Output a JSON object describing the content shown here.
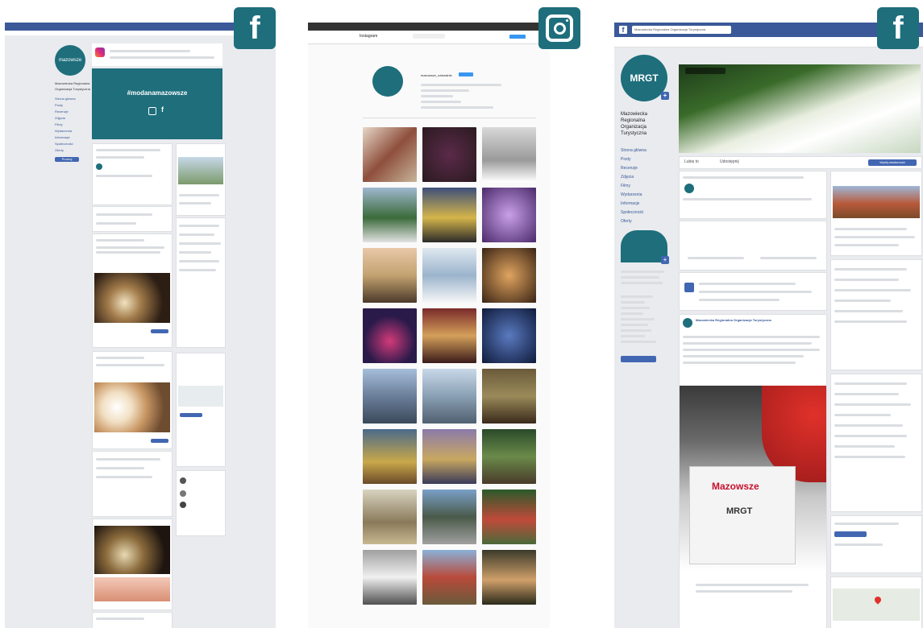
{
  "badges": {
    "facebook": "f",
    "instagram_icon": "instagram-icon"
  },
  "left": {
    "logo_text": "mazowsze",
    "cover_hashtag": "#modanamazowsze",
    "page_name": "Mazowiecka Regionalna Organizacja Turystyczna",
    "nav": [
      "Strona główna",
      "Posty",
      "Recenzje",
      "Zdjęcia",
      "Filmy",
      "Wydarzenia",
      "Informacje",
      "Społeczność",
      "Oferty"
    ],
    "button": "Promuj"
  },
  "middle": {
    "title": "Instagram",
    "username": "mazowsze_naturalnie"
  },
  "right": {
    "search_text": "Mazowiecka Regionalna Organizacja Turystyczna",
    "logo_text": "MRGT",
    "page_name": "Mazowiecka Regionalna Organizacja Turystyczna",
    "nav": [
      "Strona główna",
      "Posty",
      "Recenzje",
      "Zdjęcia",
      "Filmy",
      "Wydarzenia",
      "Informacje",
      "Społeczność",
      "Oferty"
    ],
    "post_author": "Mazowiecka Regionalna Organizacja Turystyczna",
    "stand_text": "Mazowsze",
    "stand_logo": "MRGT",
    "like_btn": "Lubię to",
    "share_btn": "Udostępnij",
    "send_btn": "Wyślij wiadomość"
  },
  "colors": {
    "fb_blue": "#3b5998",
    "teal": "#1e6e7c",
    "insta_bg": "#fafafa"
  }
}
